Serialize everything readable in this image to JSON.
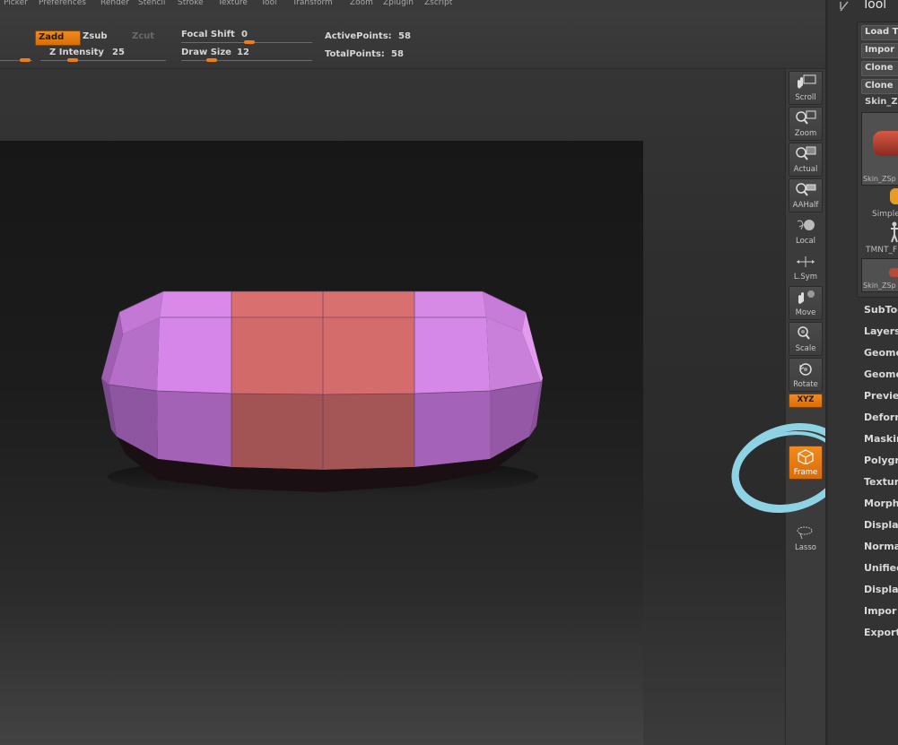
{
  "menu": {
    "items": [
      "Picker",
      "Preferences",
      "Render",
      "Stencil",
      "Stroke",
      "Texture",
      "Tool",
      "Transform",
      "Zoom",
      "Zplugin",
      "Zscript"
    ]
  },
  "toolbar": {
    "zadd": "Zadd",
    "zsub": "Zsub",
    "zcut": "Zcut",
    "focal_shift_label": "Focal Shift",
    "focal_shift_value": "0",
    "z_intensity_label": "Z Intensity",
    "z_intensity_value": "25",
    "draw_size_label": "Draw Size",
    "draw_size_value": "12",
    "active_points_label": "ActivePoints:",
    "active_points_value": "58",
    "total_points_label": "TotalPoints:",
    "total_points_value": "58"
  },
  "shelf": {
    "scroll": "Scroll",
    "zoom": "Zoom",
    "actual": "Actual",
    "aahalf": "AAHalf",
    "local": "Local",
    "lsym": "L.Sym",
    "move": "Move",
    "scale": "Scale",
    "rotate": "Rotate",
    "xyz": "XYZ",
    "frame": "Frame",
    "lasso": "Lasso"
  },
  "right_panel": {
    "title": "Tool",
    "buttons": [
      "Load T",
      "Impor",
      "Clone",
      "Clone"
    ],
    "current_tool": "Skin_Z",
    "thumb1_caption": "Skin_ZSp",
    "simple_label": "Simple",
    "tmnt_label": "TMNT_F",
    "thumb2_caption": "Skin_ZSp",
    "menu_items": [
      "SubToo",
      "Layers",
      "Geome",
      "Geome",
      "Previe",
      "Deform",
      "Maskin",
      "Polygr",
      "Texture",
      "Morph",
      "Displac",
      "Norma",
      "Unified",
      "Display",
      "Impor",
      "Export"
    ]
  },
  "colors": {
    "accent_orange": "#f07d12",
    "annotation_cyan": "#8ed3e3",
    "mesh_violet": "#cd7fe0",
    "mesh_red": "#d46a6a"
  }
}
